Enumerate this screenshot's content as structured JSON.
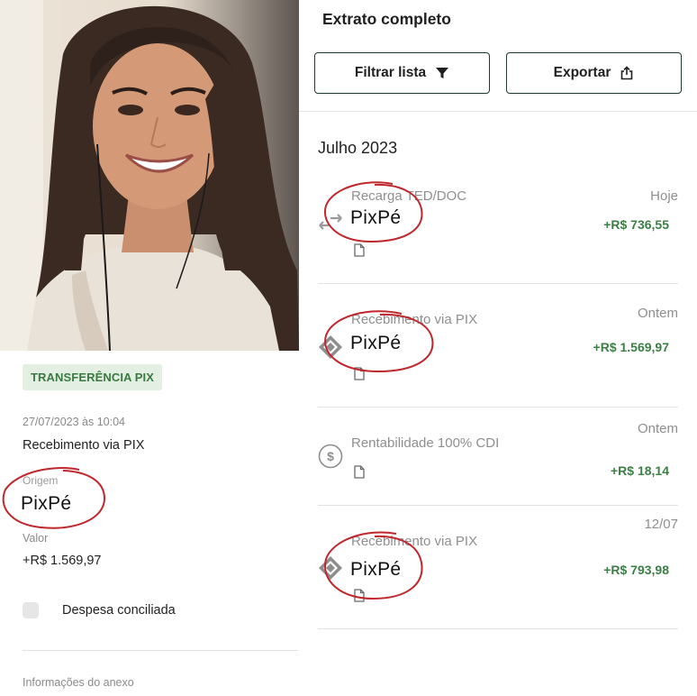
{
  "left": {
    "tag": "TRANSFERÊNCIA PIX",
    "datetime": "27/07/2023 às 10:04",
    "type": "Recebimento via PIX",
    "origin_label": "Origem",
    "origin_value": "PixPé",
    "value_label": "Valor",
    "value": "+R$ 1.569,97",
    "reconciled_label": "Despesa conciliada",
    "reconciled_checked": false,
    "attachment_info_label": "Informações do anexo"
  },
  "right": {
    "title": "Extrato completo",
    "filter_label": "Filtrar lista",
    "export_label": "Exportar",
    "month": "Julho 2023",
    "transactions": [
      {
        "title": "Recarga TED/DOC",
        "handwritten": "PixPé",
        "date": "Hoje",
        "amount": "+R$ 736,55",
        "icon": "transfer-arrows-icon"
      },
      {
        "title": "Recebimento via PIX",
        "handwritten": "PixPé",
        "date": "Ontem",
        "amount": "+R$ 1.569,97",
        "icon": "pix-icon"
      },
      {
        "title": "Rentabilidade 100% CDI",
        "handwritten": "",
        "date": "Ontem",
        "amount": "+R$ 18,14",
        "icon": "dollar-circle-icon"
      },
      {
        "title": "Recebimento via PIX",
        "handwritten": "PixPé",
        "date": "12/07",
        "amount": "+R$ 793,98",
        "icon": "pix-icon"
      }
    ]
  },
  "colors": {
    "amount_green": "#3b7f45",
    "tag_bg": "#e3efe2",
    "tag_text": "#3a7a41",
    "button_border": "#1e3a2c",
    "annotation_red": "#c0272d"
  }
}
